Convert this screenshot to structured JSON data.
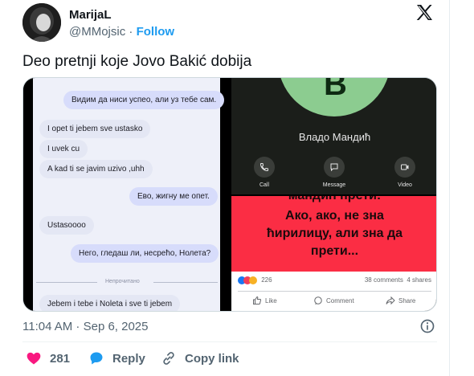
{
  "tweet": {
    "author_name": "MarijaL",
    "author_handle": "@MMojsic",
    "separator": "·",
    "follow_label": "Follow",
    "text": "Deo pretnji koje Jovo Bakić dobija",
    "timestamp": "11:04 AM · Sep 6, 2025"
  },
  "media": {
    "chat": {
      "messages": [
        {
          "dir": "out",
          "text": "Видим да ниси успео, али уз тебе сам."
        },
        {
          "dir": "in",
          "text": "I opet ti jebem sve ustasko"
        },
        {
          "dir": "in",
          "text": "I uvek cu"
        },
        {
          "dir": "in",
          "text": "A kad ti se javim uzivo ,uhh"
        },
        {
          "dir": "out",
          "text": "Ево, жигну ме опет."
        },
        {
          "dir": "in",
          "text": "Ustasoooo"
        },
        {
          "dir": "out",
          "text": "Него, гледаш ли, несрећо, Нолета?"
        },
        {
          "dir": "in",
          "text": "Jebem i tebe i Noleta i sve ti jebem"
        }
      ],
      "divider_label": "Непрочитано"
    },
    "call": {
      "contact_letter": "В",
      "contact_name": "Владо Мандић",
      "actions": {
        "call": "Call",
        "message": "Message",
        "video": "Video"
      }
    },
    "fb_post": {
      "top_cut_text": "мандић прети:",
      "lines": [
        "Ако, ако, не зна",
        "ћирилицу, али зна да",
        "прети..."
      ],
      "reaction_count": "226",
      "comments": "38 comments",
      "shares": "4 shares",
      "like_label": "Like",
      "comment_label": "Comment",
      "share_label": "Share"
    }
  },
  "engagement": {
    "likes": "281",
    "reply_label": "Reply",
    "copy_link_label": "Copy link"
  },
  "colors": {
    "accent": "#1d9bf0",
    "like": "#f91880",
    "fb_red": "#fb2d44",
    "call_green": "#8ccc90"
  }
}
